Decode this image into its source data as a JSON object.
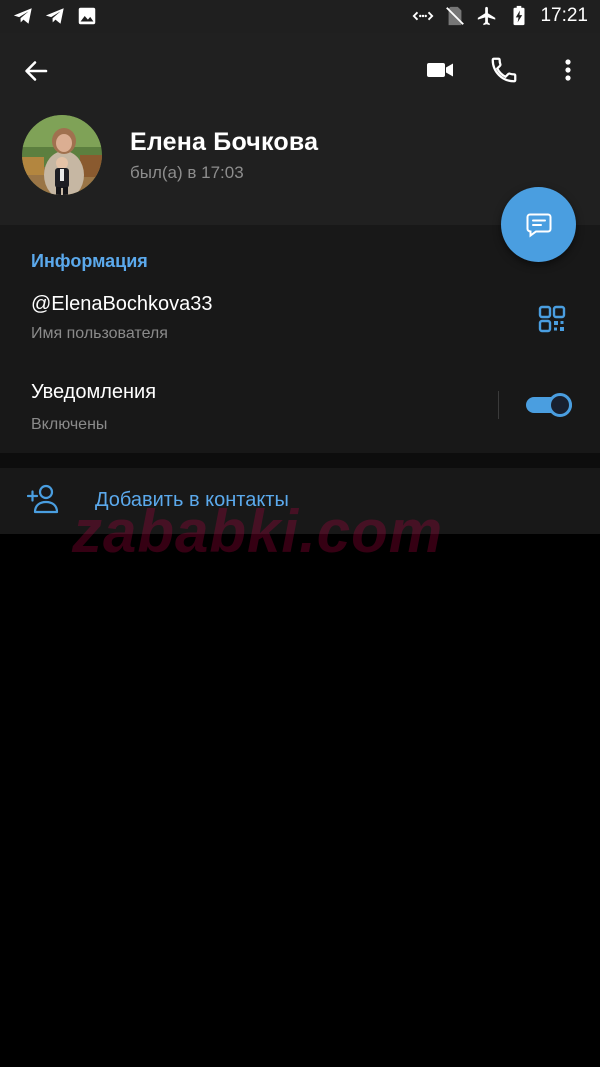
{
  "status_bar": {
    "time": "17:21",
    "left_icons": [
      "telegram-icon",
      "telegram-icon",
      "image-icon"
    ],
    "right_icons": [
      "data-saver-icon",
      "no-sim-icon",
      "airplane-mode-icon",
      "battery-charging-icon"
    ]
  },
  "header": {
    "name": "Елена Бочкова",
    "last_seen": "был(а) в 17:03",
    "actions": [
      "back-arrow-icon",
      "video-call-icon",
      "phone-icon",
      "more-vertical-icon"
    ]
  },
  "info": {
    "section_title": "Информация",
    "username": "@ElenaBochkova33",
    "username_label": "Имя пользователя",
    "notifications_title": "Уведомления",
    "notifications_status": "Включены",
    "notifications_enabled": true
  },
  "actions": {
    "add_contact_label": "Добавить в контакты"
  },
  "watermark": "zababki.com",
  "colors": {
    "accent": "#4a9ee0",
    "link": "#5ba9ec",
    "header_bg": "#202020",
    "section_bg": "#181818",
    "background": "#000000"
  }
}
